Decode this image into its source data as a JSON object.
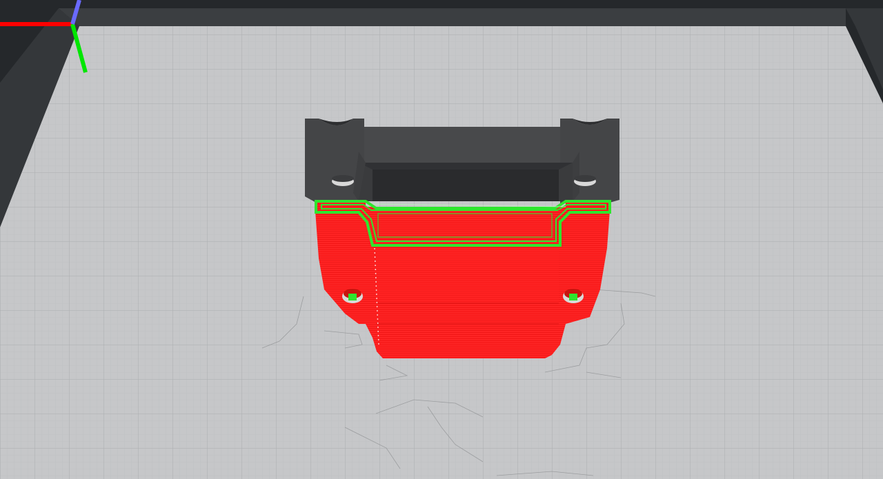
{
  "scene": {
    "background_color": "#25282b",
    "bed_color": "#c5c6c8",
    "bed_grid_minor_color": "#b8babc",
    "bed_grid_major_color": "#a9abad",
    "bed_frame_color": "#3a3d40",
    "model_top_color": "#4a4b4d",
    "model_layer_color": "#ff1d1d",
    "current_layer_color": "#2ee62e"
  },
  "axes": {
    "x_color": "#ff0000",
    "y_color": "#00e600",
    "z_color": "#6a6aff",
    "x_icon": "x-axis-arrow-icon",
    "y_icon": "y-axis-arrow-icon",
    "z_icon": "z-axis-arrow-icon"
  }
}
